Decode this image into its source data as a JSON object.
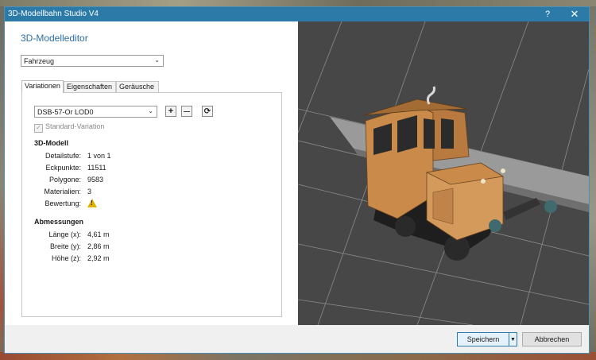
{
  "window": {
    "title": "3D-Modellbahn Studio V4",
    "help_glyph": "?",
    "close_glyph": "✕"
  },
  "editor": {
    "title": "3D-Modelleditor",
    "category_select": "Fahrzeug",
    "tabs": [
      "Variationen",
      "Eigenschaften",
      "Geräusche"
    ],
    "active_tab": "Variationen",
    "variant_select": "DSB-57-Or LOD0",
    "add_glyph": "+",
    "remove_glyph": "—",
    "refresh_glyph": "⟳",
    "standard_variation_label": "Standard-Variation",
    "model_section": {
      "title": "3D-Modell",
      "rows": [
        {
          "label": "Detailstufe:",
          "value": "1 von 1"
        },
        {
          "label": "Eckpunkte:",
          "value": "11511"
        },
        {
          "label": "Polygone:",
          "value": "9583"
        },
        {
          "label": "Materialien:",
          "value": "3"
        },
        {
          "label": "Bewertung:",
          "value": ""
        }
      ]
    },
    "dimensions_section": {
      "title": "Abmessungen",
      "rows": [
        {
          "label": "Länge (x):",
          "value": "4,61 m"
        },
        {
          "label": "Breite (y):",
          "value": "2,86 m"
        },
        {
          "label": "Höhe (z):",
          "value": "2,92 m"
        }
      ]
    }
  },
  "buttons": {
    "save": "Speichern",
    "cancel": "Abbrechen"
  },
  "colors": {
    "titlebar": "#2b7aa8",
    "accent_title": "#2e6fa6",
    "viewport_bg": "#474747",
    "loco_body": "#c98a4a"
  },
  "icons": {
    "warning": "warning-icon",
    "refresh": "refresh-icon",
    "dropdown": "chevron-down-icon"
  }
}
